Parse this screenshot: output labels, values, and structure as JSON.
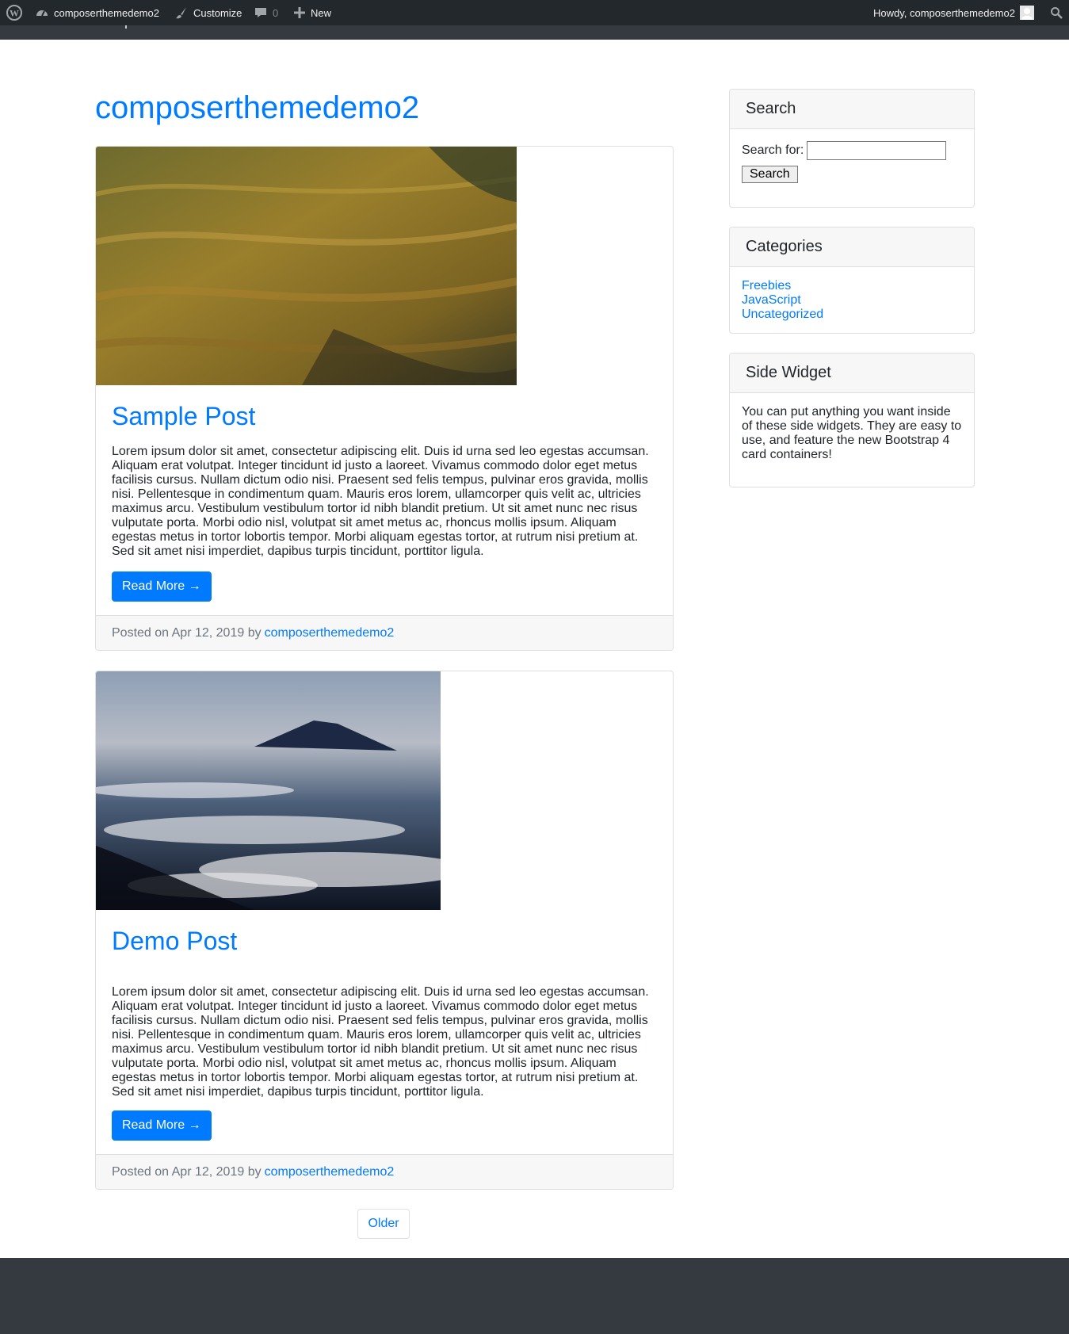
{
  "admin_bar": {
    "site_name": "composerthemedemo2",
    "customize": "Customize",
    "comments_count": "0",
    "new": "New",
    "howdy": "Howdy, composerthemedemo2"
  },
  "site": {
    "title": "composerthemedemo2"
  },
  "posts": [
    {
      "title": "Sample Post",
      "excerpt": "Lorem ipsum dolor sit amet, consectetur adipiscing elit. Duis id urna sed leo egestas accumsan. Aliquam erat volutpat. Integer tincidunt id justo a laoreet. Vivamus commodo dolor eget metus facilisis cursus. Nullam dictum odio nisi. Praesent sed felis tempus, pulvinar eros gravida, mollis nisi. Pellentesque in condimentum quam. Mauris eros lorem, ullamcorper quis velit ac, ultricies maximus arcu. Vestibulum vestibulum tortor id nibh blandit pretium. Ut sit amet nunc nec risus vulputate porta. Morbi odio nisl, volutpat sit amet metus ac, rhoncus mollis ipsum. Aliquam egestas metus in tortor lobortis tempor. Morbi aliquam egestas tortor, at rutrum nisi pretium at. Sed sit amet nisi imperdiet, dapibus turpis tincidunt, porttitor ligula.",
      "read_more": "Read More →",
      "posted_on": "Posted on Apr 12, 2019 by",
      "author": "composerthemedemo2"
    },
    {
      "title": "Demo Post",
      "excerpt": "Lorem ipsum dolor sit amet, consectetur adipiscing elit. Duis id urna sed leo egestas accumsan. Aliquam erat volutpat. Integer tincidunt id justo a laoreet. Vivamus commodo dolor eget metus facilisis cursus. Nullam dictum odio nisi. Praesent sed felis tempus, pulvinar eros gravida, mollis nisi. Pellentesque in condimentum quam. Mauris eros lorem, ullamcorper quis velit ac, ultricies maximus arcu. Vestibulum vestibulum tortor id nibh blandit pretium. Ut sit amet nunc nec risus vulputate porta. Morbi odio nisl, volutpat sit amet metus ac, rhoncus mollis ipsum. Aliquam egestas metus in tortor lobortis tempor. Morbi aliquam egestas tortor, at rutrum nisi pretium at. Sed sit amet nisi imperdiet, dapibus turpis tincidunt, porttitor ligula.",
      "read_more": "Read More →",
      "posted_on": "Posted on Apr 12, 2019 by",
      "author": "composerthemedemo2"
    }
  ],
  "pagination": {
    "older": "Older"
  },
  "sidebar": {
    "search": {
      "title": "Search",
      "label": "Search for:",
      "button": "Search",
      "value": ""
    },
    "categories": {
      "title": "Categories",
      "items": [
        "Freebies",
        "JavaScript",
        "Uncategorized"
      ]
    },
    "side_widget": {
      "title": "Side Widget",
      "text": "You can put anything you want inside of these side widgets. They are easy to use, and feature the new Bootstrap 4 card containers!"
    }
  },
  "colors": {
    "accent": "#007bff",
    "admin_bar": "#23282d",
    "footer": "#343a40"
  },
  "icons": [
    "wordpress-icon",
    "dashboard-icon",
    "brush-icon",
    "comment-icon",
    "plus-icon",
    "avatar-icon",
    "search-icon"
  ]
}
